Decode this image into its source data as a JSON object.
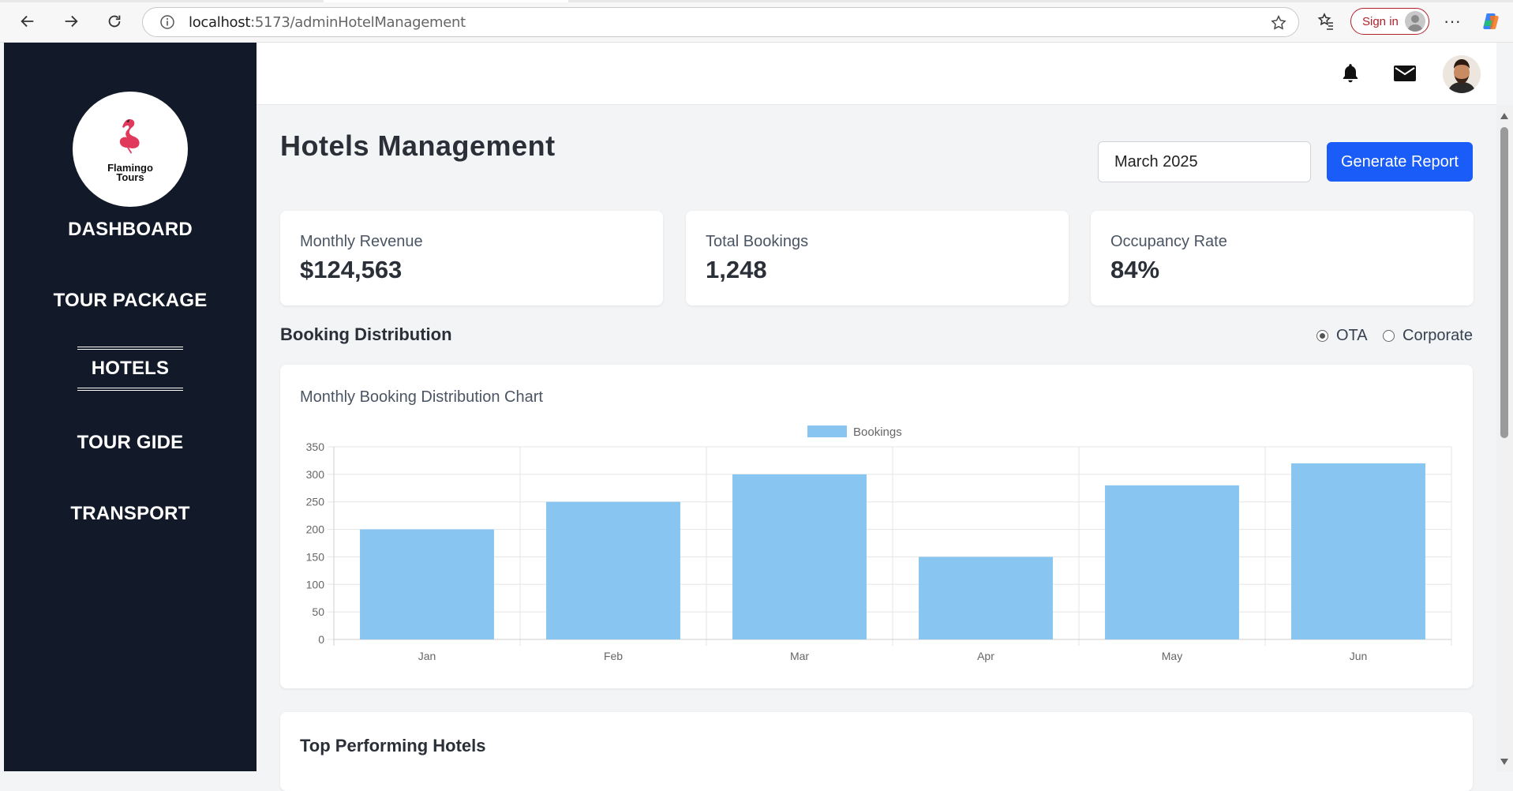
{
  "browser": {
    "url_host": "localhost",
    "url_rest": ":5173/adminHotelManagement",
    "signin_label": "Sign in"
  },
  "sidebar": {
    "logo_line1": "Flamingo",
    "logo_line2": "Tours",
    "items": [
      {
        "label": "DASHBOARD"
      },
      {
        "label": "TOUR PACKAGE"
      },
      {
        "label": "HOTELS"
      },
      {
        "label": "TOUR GIDE"
      },
      {
        "label": "TRANSPORT"
      }
    ],
    "active": "HOTELS"
  },
  "header": {
    "title": "Hotels Management",
    "month_value": "March 2025",
    "generate_label": "Generate Report"
  },
  "stats": [
    {
      "label": "Monthly Revenue",
      "value": "$124,563"
    },
    {
      "label": "Total Bookings",
      "value": "1,248"
    },
    {
      "label": "Occupancy Rate",
      "value": "84%"
    }
  ],
  "distribution": {
    "title": "Booking Distribution",
    "options": [
      {
        "label": "OTA",
        "checked": true
      },
      {
        "label": "Corporate",
        "checked": false
      }
    ],
    "chart_title": "Monthly Booking Distribution Chart"
  },
  "chart_data": {
    "type": "bar",
    "categories": [
      "Jan",
      "Feb",
      "Mar",
      "Apr",
      "May",
      "Jun"
    ],
    "series": [
      {
        "name": "Bookings",
        "values": [
          200,
          250,
          300,
          150,
          280,
          320
        ]
      }
    ],
    "ylim": [
      0,
      350
    ],
    "yticks": [
      0,
      50,
      100,
      150,
      200,
      250,
      300,
      350
    ],
    "legend": "top-center",
    "grid": true,
    "bar_color": "#88c5f1"
  },
  "bottom": {
    "title": "Top Performing Hotels"
  },
  "colors": {
    "sidebar_bg": "#121a2a",
    "accent": "#1a5cf7",
    "page_bg": "#f3f4f6"
  }
}
